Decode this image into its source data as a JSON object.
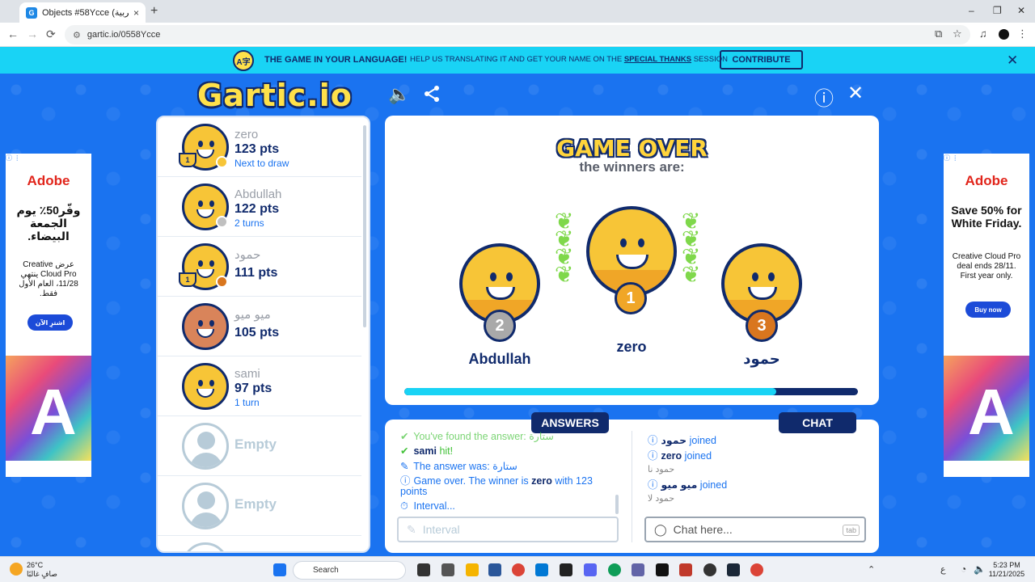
{
  "browser": {
    "tab_title": "Objects #58Ycce (العربية) - G",
    "url": "gartic.io/0558Ycce",
    "new_tab": "+",
    "tab_close": "×",
    "back": "←",
    "forward": "→",
    "reload": "⟳",
    "minimize": "–",
    "maximize": "❐",
    "close": "✕"
  },
  "banner": {
    "icon_text": "A字",
    "headline": "THE GAME IN YOUR LANGUAGE!",
    "text_before": "HELP US TRANSLATING IT AND GET YOUR NAME ON THE",
    "link": "SPECIAL THANKS",
    "text_after": "SESSION",
    "contribute": "CONTRIBUTE",
    "close": "✕"
  },
  "game": {
    "logo": "Gartic.io",
    "header_icons": [
      "sound-icon",
      "share-icon",
      "info-icon",
      "close-icon"
    ],
    "sound_glyph": "🔈",
    "share_glyph": "⟨",
    "info_glyph": "ⓘ",
    "close_glyph": "✕"
  },
  "players": [
    {
      "name": "zero",
      "points": "123 pts",
      "note": "Next to draw",
      "trophy": "1",
      "dot_color": "#f7c537",
      "avatar": "yellow"
    },
    {
      "name": "Abdullah",
      "points": "122 pts",
      "note": "2 turns",
      "trophy": "",
      "dot_color": "#c0c0c0",
      "avatar": "yellow"
    },
    {
      "name": "حمود",
      "points": "111 pts",
      "note": "",
      "trophy": "1",
      "dot_color": "#d9761e",
      "avatar": "yellow"
    },
    {
      "name": "ميو ميو",
      "points": "105 pts",
      "note": "",
      "trophy": "",
      "dot_color": "",
      "avatar": "brown"
    },
    {
      "name": "sami",
      "points": "97 pts",
      "note": "1 turn",
      "trophy": "",
      "dot_color": "",
      "avatar": "yellow"
    }
  ],
  "empty_slots": [
    "Empty",
    "Empty"
  ],
  "game_over": {
    "title": "GAME OVER",
    "subtitle": "the winners are:",
    "first": {
      "name": "zero",
      "place": "1"
    },
    "second": {
      "name": "Abdullah",
      "place": "2"
    },
    "third": {
      "name": "حمود",
      "place": "3"
    },
    "progress": 0.82
  },
  "answers": {
    "tab": "ANSWERS",
    "messages": [
      {
        "icon": "✔",
        "text": "You've found the answer: ستارة",
        "style": "green"
      },
      {
        "icon": "✔",
        "user": "sami",
        "text": " hit!",
        "style": "green"
      },
      {
        "icon": "✎",
        "text": "The answer was: ستارة",
        "style": "blue"
      },
      {
        "icon": "ⓘ",
        "text": "Game over. The winner is ",
        "user": "zero",
        "text2": " with 123 points",
        "style": "blue"
      },
      {
        "icon": "⏱",
        "text": "Interval...",
        "style": "blue"
      }
    ],
    "placeholder": "Interval"
  },
  "chat": {
    "tab": "CHAT",
    "messages": [
      {
        "icon": "ⓘ",
        "user": "حمود",
        "text": " joined",
        "style": "blue"
      },
      {
        "icon": "ⓘ",
        "user": "zero",
        "text": " joined",
        "style": "blue"
      },
      {
        "text": "حمود نا",
        "style": "gray"
      },
      {
        "icon": "ⓘ",
        "user": "ميو ميو",
        "text": " joined",
        "style": "blue"
      },
      {
        "text": "حمود لا",
        "style": "gray"
      }
    ],
    "placeholder": "Chat here...",
    "tab_key": "tab"
  },
  "ads": {
    "left": {
      "brand": "Adobe",
      "headline": "وفّر50٪ يوم الجمعة البيضاء.",
      "body": "عرض Creative Cloud Pro ينتهي 11/28، العام الأول فقط.",
      "button": "اشترِ الآن"
    },
    "right": {
      "brand": "Adobe",
      "headline": "Save 50% for White Friday.",
      "body": "Creative Cloud Pro deal ends 28/11. First year only.",
      "button": "Buy now"
    }
  },
  "taskbar": {
    "temp": "26°C",
    "weather": "صافٍ غالبًا",
    "search": "Search",
    "lang": "ع",
    "time": "5:23 PM",
    "date": "11/21/2025"
  }
}
